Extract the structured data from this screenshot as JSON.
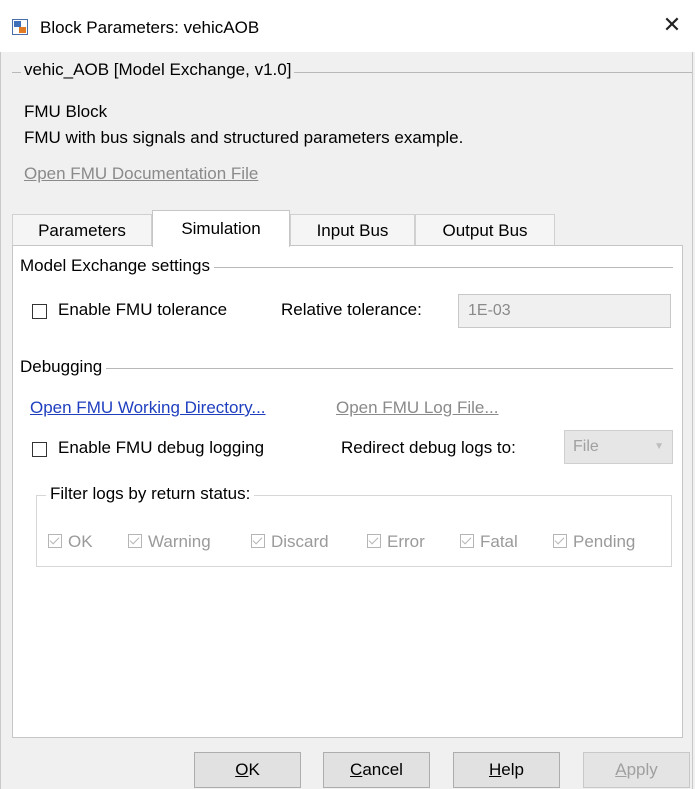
{
  "window": {
    "title": "Block Parameters: vehicAOB",
    "close_symbol": "✕"
  },
  "description": {
    "group_title": "vehic_AOB [Model Exchange, v1.0]",
    "block_type": "FMU Block",
    "text": "FMU with bus signals and structured parameters example.",
    "doc_link": "Open FMU Documentation File"
  },
  "tabs": [
    {
      "label": "Parameters",
      "active": false
    },
    {
      "label": "Simulation",
      "active": true
    },
    {
      "label": "Input Bus",
      "active": false
    },
    {
      "label": "Output Bus",
      "active": false
    }
  ],
  "model_exchange": {
    "section_title": "Model Exchange settings",
    "enable_tolerance_label": "Enable FMU tolerance",
    "enable_tolerance_checked": false,
    "relative_tolerance_label": "Relative tolerance:",
    "relative_tolerance_value": "1E-03"
  },
  "debugging": {
    "section_title": "Debugging",
    "open_working_dir": "Open FMU Working Directory...",
    "open_log_file": "Open FMU Log File...",
    "enable_debug_label": "Enable FMU debug logging",
    "enable_debug_checked": false,
    "redirect_label": "Redirect debug logs to:",
    "redirect_value": "File",
    "filter_title": "Filter logs by return status:",
    "filters": [
      {
        "label": "OK",
        "checked": true
      },
      {
        "label": "Warning",
        "checked": true
      },
      {
        "label": "Discard",
        "checked": true
      },
      {
        "label": "Error",
        "checked": true
      },
      {
        "label": "Fatal",
        "checked": true
      },
      {
        "label": "Pending",
        "checked": true
      }
    ]
  },
  "buttons": {
    "ok": {
      "accel": "O",
      "rest": "K"
    },
    "cancel": {
      "accel": "C",
      "rest": "ancel"
    },
    "help": {
      "accel": "H",
      "rest": "elp"
    },
    "apply": {
      "accel": "A",
      "rest": "pply",
      "disabled": true
    }
  },
  "colors": {
    "link": "#1f3fbf",
    "disabled_text": "#8a8a8a",
    "panel": "#ffffff",
    "dialog_bg": "#f0f0f0"
  }
}
